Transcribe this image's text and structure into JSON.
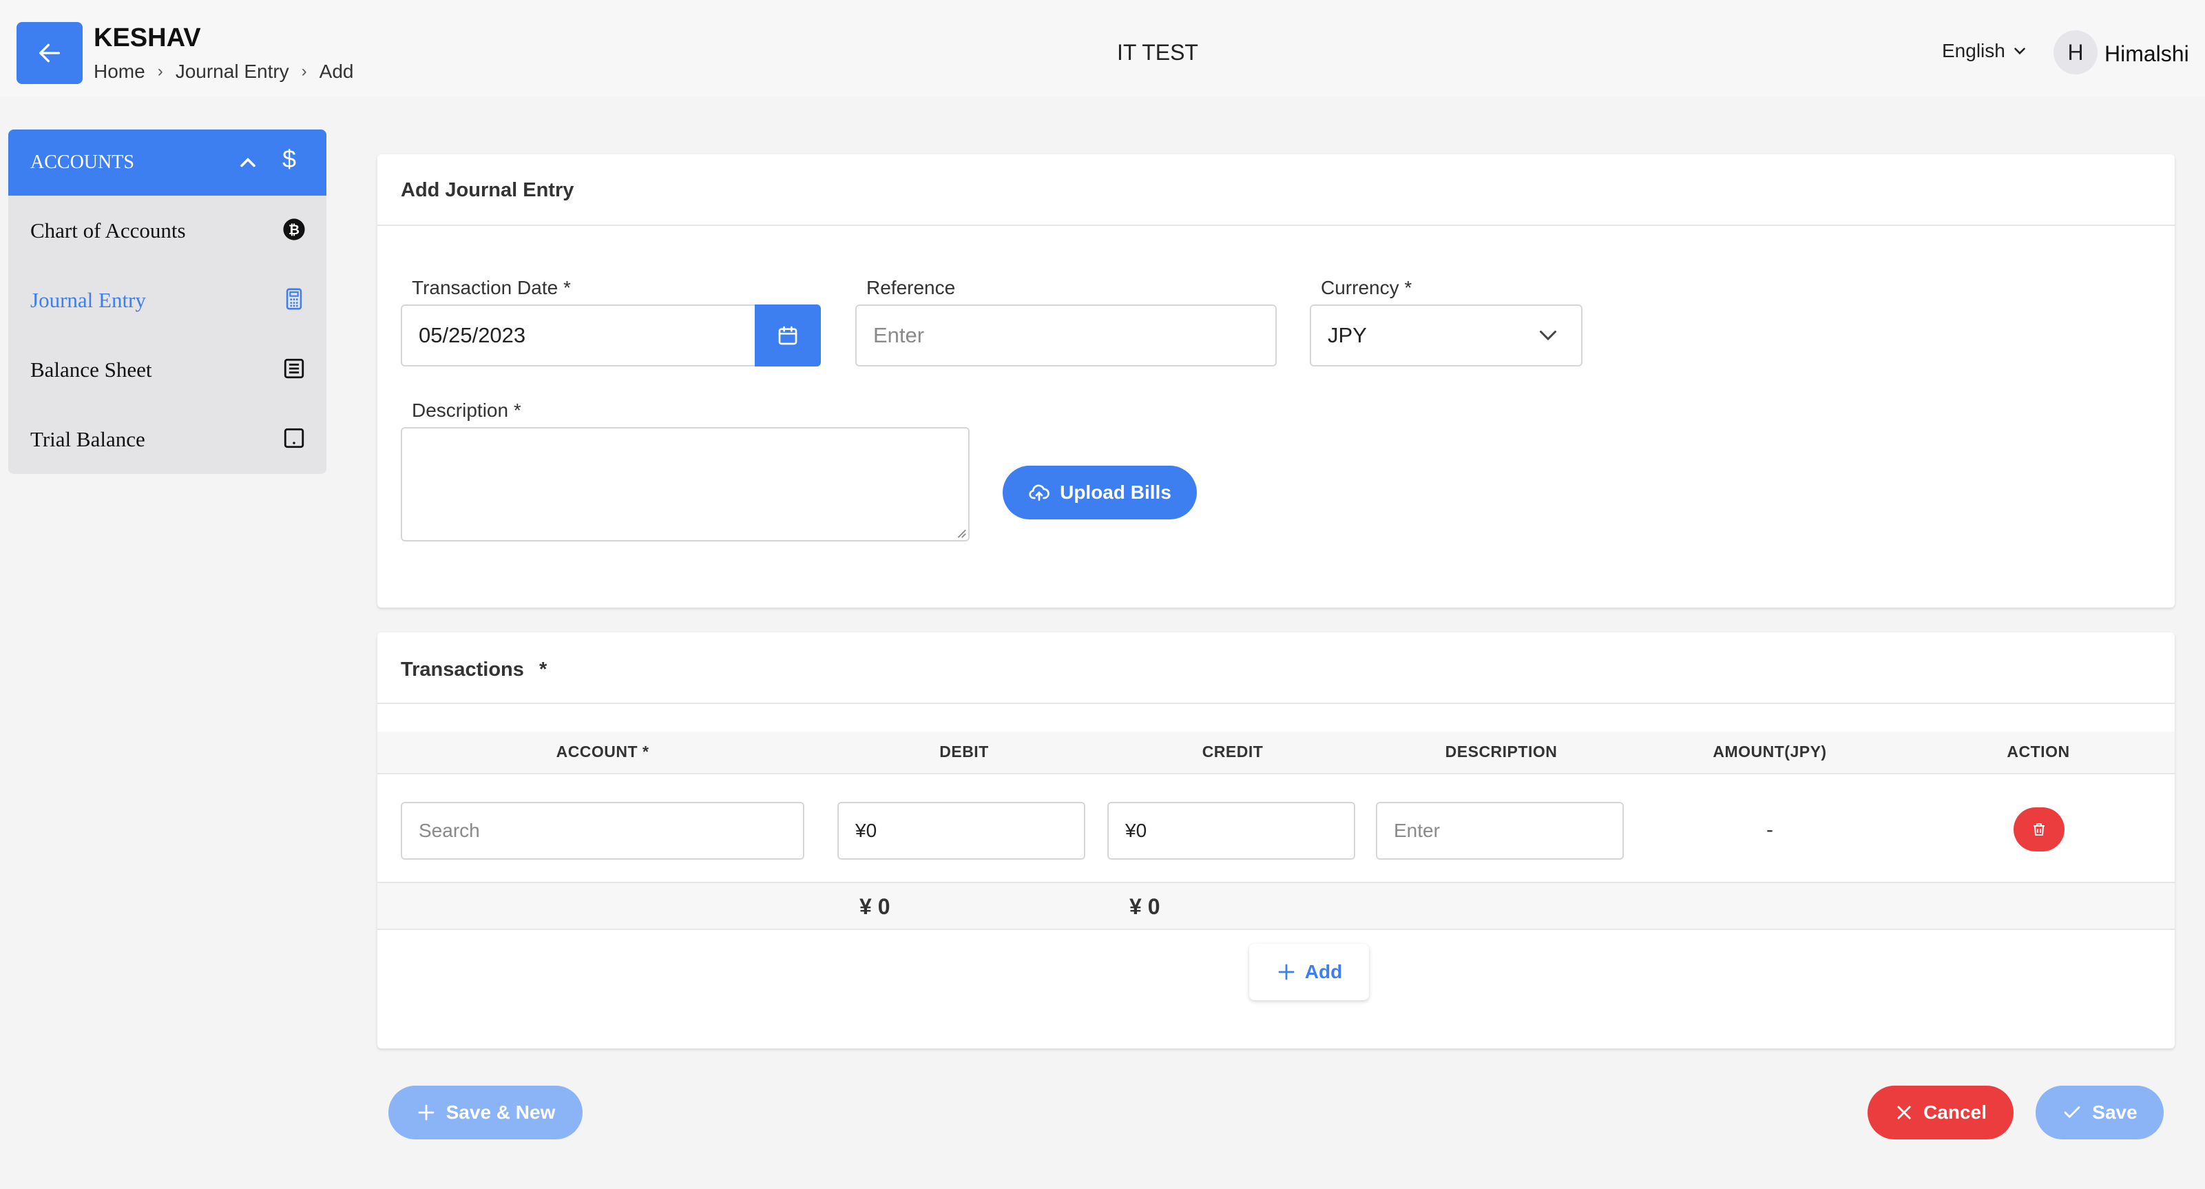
{
  "header": {
    "brand": "KESHAV",
    "breadcrumb": [
      "Home",
      "Journal Entry",
      "Add"
    ],
    "center_title": "IT TEST",
    "language": "English",
    "avatar_initial": "H",
    "username": "Himalshi"
  },
  "sidebar": {
    "section_title": "ACCOUNTS",
    "items": [
      {
        "label": "Chart of Accounts",
        "icon": "bitcoin-icon"
      },
      {
        "label": "Journal Entry",
        "icon": "calculator-icon",
        "active": true
      },
      {
        "label": "Balance Sheet",
        "icon": "document-icon"
      },
      {
        "label": "Trial Balance",
        "icon": "tablet-icon"
      }
    ]
  },
  "form": {
    "title": "Add Journal Entry",
    "transaction_date_label": "Transaction Date *",
    "transaction_date_value": "05/25/2023",
    "reference_label": "Reference",
    "reference_placeholder": "Enter",
    "currency_label": "Currency *",
    "currency_value": "JPY",
    "description_label": "Description *",
    "upload_label": "Upload Bills"
  },
  "transactions": {
    "title": "Transactions",
    "required_mark": "*",
    "columns": [
      "ACCOUNT *",
      "DEBIT",
      "CREDIT",
      "DESCRIPTION",
      "AMOUNT(JPY)",
      "ACTION"
    ],
    "row": {
      "account_placeholder": "Search",
      "debit_value": "¥0",
      "credit_value": "¥0",
      "description_placeholder": "Enter",
      "amount": "-"
    },
    "total_debit": "¥ 0",
    "total_credit": "¥ 0",
    "add_label": "Add"
  },
  "actions": {
    "save_new": "Save & New",
    "cancel": "Cancel",
    "save": "Save"
  },
  "colors": {
    "primary": "#3d7ef0",
    "danger": "#eb3d3d",
    "primary_disabled": "#8ab4f6"
  }
}
